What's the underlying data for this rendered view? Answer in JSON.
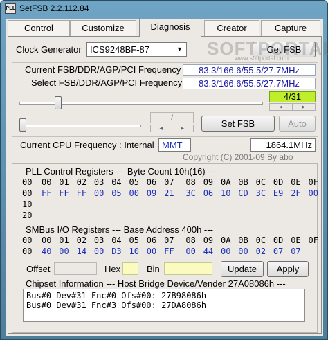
{
  "window": {
    "title": "SetFSB 2.2.112.84",
    "icon_text": "PLL"
  },
  "watermark": {
    "main": "SOFTPORTAL",
    "sub": "www.softportal.com"
  },
  "tabs": [
    {
      "label": "Control"
    },
    {
      "label": "Customize"
    },
    {
      "label": "Diagnosis"
    },
    {
      "label": "Creator"
    },
    {
      "label": "Capture"
    }
  ],
  "clock": {
    "label": "Clock Generator",
    "selected": "ICS9248BF-87",
    "get_fsb": "Get FSB"
  },
  "fsb": {
    "current_label": "Current FSB/DDR/AGP/PCI Frequency",
    "current_value": "83.3/166.6/55.5/27.7MHz",
    "select_label": "Select FSB/DDR/AGP/PCI Frequency",
    "select_value": "83.3/166.6/55.5/27.7MHz",
    "counter": "4/31",
    "slider1_level": 0.15,
    "slider2_level": 0.0,
    "aux_value": "/",
    "set_fsb": "Set FSB",
    "auto": "Auto"
  },
  "cpu": {
    "label": "Current CPU Frequency : Internal",
    "source": "MMT",
    "value": "1864.1MHz",
    "copyright": "Copyright (C) 2001-09 By abo"
  },
  "pll": {
    "title": "PLL Control Registers  --- Byte Count 10h(16) ---",
    "headers": [
      "00",
      "01",
      "02",
      "03",
      "04",
      "05",
      "06",
      "07",
      "08",
      "09",
      "0A",
      "0B",
      "0C",
      "0D",
      "0E",
      "0F"
    ],
    "rows": [
      {
        "addr": "00",
        "values": [
          "FF",
          "FF",
          "FF",
          "00",
          "05",
          "00",
          "09",
          "21",
          "3C",
          "06",
          "10",
          "CD",
          "3C",
          "E9",
          "2F",
          "00"
        ]
      },
      {
        "addr": "10",
        "values": []
      },
      {
        "addr": "20",
        "values": []
      }
    ]
  },
  "smbus": {
    "title": "SMBus I/O Registers  --- Base Address 400h ---",
    "headers": [
      "00",
      "01",
      "02",
      "03",
      "04",
      "05",
      "06",
      "07",
      "08",
      "09",
      "0A",
      "0B",
      "0C",
      "0D",
      "0E",
      "0F"
    ],
    "rows": [
      {
        "addr": "00",
        "values": [
          "40",
          "00",
          "14",
          "00",
          "D3",
          "10",
          "00",
          "FF",
          "00",
          "44",
          "00",
          "00",
          "02",
          "07",
          "07"
        ]
      }
    ]
  },
  "edit": {
    "offset_label": "Offset",
    "hex_label": "Hex",
    "bin_label": "Bin",
    "update": "Update",
    "apply": "Apply"
  },
  "chipset": {
    "title": "Chipset Information  --- Host Bridge Device/Vender 27A08086h ---",
    "lines": [
      "Bus#0 Dev#31 Fnc#0 Ofs#00: 27B98086h",
      "Bus#0 Dev#31 Fnc#3 Ofs#00: 27DA8086h"
    ]
  }
}
